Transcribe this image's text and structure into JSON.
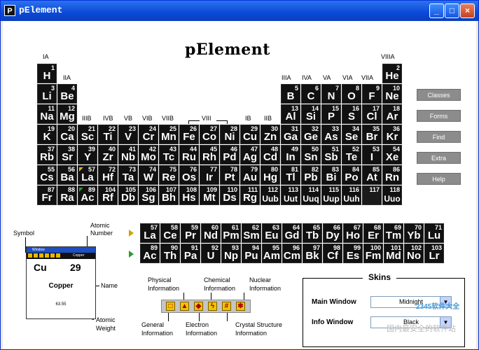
{
  "window": {
    "title": "pElement",
    "icon_letter": "P",
    "min_glyph": "_",
    "max_glyph": "□",
    "close_glyph": "×"
  },
  "app_title": "pElement",
  "group_labels": [
    "IA",
    "IIA",
    "IIIA",
    "IVA",
    "VA",
    "VIA",
    "VIIA",
    "VIIIA",
    "IIIB",
    "IVB",
    "VB",
    "VIB",
    "VIIB",
    "VIII",
    "IB",
    "IIB"
  ],
  "elements": [
    [
      1,
      "H"
    ],
    [
      2,
      "He"
    ],
    [
      3,
      "Li"
    ],
    [
      4,
      "Be"
    ],
    [
      5,
      "B"
    ],
    [
      6,
      "C"
    ],
    [
      7,
      "N"
    ],
    [
      8,
      "O"
    ],
    [
      9,
      "F"
    ],
    [
      10,
      "Ne"
    ],
    [
      11,
      "Na"
    ],
    [
      12,
      "Mg"
    ],
    [
      13,
      "Al"
    ],
    [
      14,
      "Si"
    ],
    [
      15,
      "P"
    ],
    [
      16,
      "S"
    ],
    [
      17,
      "Cl"
    ],
    [
      18,
      "Ar"
    ],
    [
      19,
      "K"
    ],
    [
      20,
      "Ca"
    ],
    [
      21,
      "Sc"
    ],
    [
      22,
      "Ti"
    ],
    [
      23,
      "V"
    ],
    [
      24,
      "Cr"
    ],
    [
      25,
      "Mn"
    ],
    [
      26,
      "Fe"
    ],
    [
      27,
      "Co"
    ],
    [
      28,
      "Ni"
    ],
    [
      29,
      "Cu"
    ],
    [
      30,
      "Zn"
    ],
    [
      31,
      "Ga"
    ],
    [
      32,
      "Ge"
    ],
    [
      33,
      "As"
    ],
    [
      34,
      "Se"
    ],
    [
      35,
      "Br"
    ],
    [
      36,
      "Kr"
    ],
    [
      37,
      "Rb"
    ],
    [
      38,
      "Sr"
    ],
    [
      39,
      "Y"
    ],
    [
      40,
      "Zr"
    ],
    [
      41,
      "Nb"
    ],
    [
      42,
      "Mo"
    ],
    [
      43,
      "Tc"
    ],
    [
      44,
      "Ru"
    ],
    [
      45,
      "Rh"
    ],
    [
      46,
      "Pd"
    ],
    [
      47,
      "Ag"
    ],
    [
      48,
      "Cd"
    ],
    [
      49,
      "In"
    ],
    [
      50,
      "Sn"
    ],
    [
      51,
      "Sb"
    ],
    [
      52,
      "Te"
    ],
    [
      53,
      "I"
    ],
    [
      54,
      "Xe"
    ],
    [
      55,
      "Cs"
    ],
    [
      56,
      "Ba"
    ],
    [
      57,
      "La"
    ],
    [
      72,
      "Hf"
    ],
    [
      73,
      "Ta"
    ],
    [
      74,
      "W"
    ],
    [
      75,
      "Re"
    ],
    [
      76,
      "Os"
    ],
    [
      77,
      "Ir"
    ],
    [
      78,
      "Pt"
    ],
    [
      79,
      "Au"
    ],
    [
      80,
      "Hg"
    ],
    [
      81,
      "Tl"
    ],
    [
      82,
      "Pb"
    ],
    [
      83,
      "Bi"
    ],
    [
      84,
      "Po"
    ],
    [
      85,
      "At"
    ],
    [
      86,
      "Rn"
    ],
    [
      87,
      "Fr"
    ],
    [
      88,
      "Ra"
    ],
    [
      89,
      "Ac"
    ],
    [
      104,
      "Rf"
    ],
    [
      105,
      "Db"
    ],
    [
      106,
      "Sg"
    ],
    [
      107,
      "Bh"
    ],
    [
      108,
      "Hs"
    ],
    [
      109,
      "Mt"
    ],
    [
      110,
      "Ds"
    ],
    [
      111,
      "Rg"
    ],
    [
      112,
      "Uub"
    ],
    [
      113,
      "Uut"
    ],
    [
      114,
      "Uuq"
    ],
    [
      115,
      "Uup"
    ],
    [
      116,
      "Uuh"
    ],
    [
      117,
      ""
    ],
    [
      118,
      "Uuo"
    ]
  ],
  "lanthanides": [
    [
      57,
      "La"
    ],
    [
      58,
      "Ce"
    ],
    [
      59,
      "Pr"
    ],
    [
      60,
      "Nd"
    ],
    [
      61,
      "Pm"
    ],
    [
      62,
      "Sm"
    ],
    [
      63,
      "Eu"
    ],
    [
      64,
      "Gd"
    ],
    [
      65,
      "Tb"
    ],
    [
      66,
      "Dy"
    ],
    [
      67,
      "Ho"
    ],
    [
      68,
      "Er"
    ],
    [
      69,
      "Tm"
    ],
    [
      70,
      "Yb"
    ],
    [
      71,
      "Lu"
    ]
  ],
  "actinides": [
    [
      89,
      "Ac"
    ],
    [
      90,
      "Th"
    ],
    [
      91,
      "Pa"
    ],
    [
      92,
      "U"
    ],
    [
      93,
      "Np"
    ],
    [
      94,
      "Pu"
    ],
    [
      95,
      "Am"
    ],
    [
      96,
      "Cm"
    ],
    [
      97,
      "Bk"
    ],
    [
      98,
      "Cf"
    ],
    [
      99,
      "Es"
    ],
    [
      100,
      "Fm"
    ],
    [
      101,
      "Md"
    ],
    [
      102,
      "No"
    ],
    [
      103,
      "Lr"
    ]
  ],
  "side_buttons": [
    "Classes",
    "Forms",
    "Find",
    "Extra",
    "Help"
  ],
  "legend": {
    "symbol_label": "Symbol",
    "atomic_number_label_1": "Atomic",
    "atomic_number_label_2": "Number",
    "name_label": "Name",
    "atomic_weight_label_1": "Atomic",
    "atomic_weight_label_2": "Weight",
    "window_title": "Window",
    "element_tag": "Copper",
    "symbol": "Cu",
    "number": "29",
    "name": "Copper",
    "weight": "63.55"
  },
  "toolbar_labels": {
    "physical_1": "Physical",
    "physical_2": "Information",
    "chemical_1": "Chemical",
    "chemical_2": "Information",
    "nuclear_1": "Nuclear",
    "nuclear_2": "Information",
    "general_1": "General",
    "general_2": "Information",
    "electron_1": "Electron",
    "electron_2": "Information",
    "crystal_1": "Crystal Structure",
    "crystal_2": "Information"
  },
  "skins": {
    "title": "Skins",
    "main_label": "Main Window",
    "main_value": "Midnight",
    "info_label": "Info Window",
    "info_value": "Black"
  },
  "watermark": "国内最安全的软件站",
  "watermark2": "2345软件大全"
}
